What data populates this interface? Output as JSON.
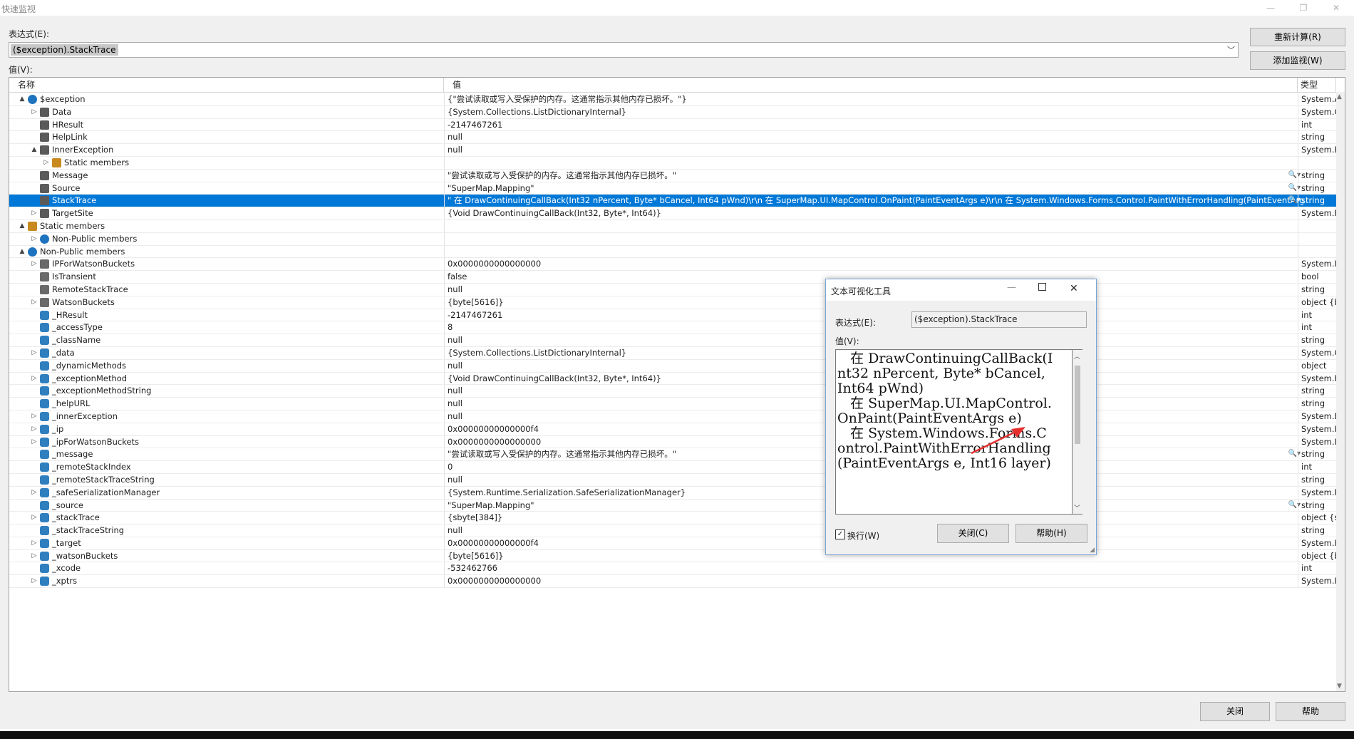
{
  "window": {
    "title": "快速监视",
    "minimize_icon": "minimize-icon",
    "restore_icon": "restore-icon",
    "close_icon": "close-icon"
  },
  "expression": {
    "label": "表达式(E):",
    "value": "($exception).StackTrace"
  },
  "buttons": {
    "recalculate": "重新计算(R)",
    "add_watch": "添加监视(W)",
    "close": "关闭",
    "help": "帮助"
  },
  "value_label": "值(V):",
  "grid": {
    "columns": {
      "name": "名称",
      "value": "值",
      "type": "类型"
    },
    "rows": [
      {
        "indent": 1,
        "exp": "▲",
        "icon": "object-icon",
        "name": "$exception",
        "value": "{\"尝试读取或写入受保护的内存。这通常指示其他内存已损坏。\"}",
        "type": "System.A"
      },
      {
        "indent": 2,
        "exp": "▷",
        "icon": "property-icon",
        "name": "Data",
        "value": "{System.Collections.ListDictionaryInternal}",
        "type": "System.C"
      },
      {
        "indent": 2,
        "exp": "",
        "icon": "property-icon",
        "name": "HResult",
        "value": "-2147467261",
        "type": "int"
      },
      {
        "indent": 2,
        "exp": "",
        "icon": "property-icon",
        "name": "HelpLink",
        "value": "null",
        "type": "string"
      },
      {
        "indent": 2,
        "exp": "▲",
        "icon": "property-icon",
        "name": "InnerException",
        "value": "null",
        "type": "System.E"
      },
      {
        "indent": 3,
        "exp": "▷",
        "icon": "static-members-icon",
        "name": "Static members",
        "value": "",
        "type": ""
      },
      {
        "indent": 2,
        "exp": "",
        "icon": "property-icon",
        "name": "Message",
        "value": "\"尝试读取或写入受保护的内存。这通常指示其他内存已损坏。\"",
        "type": "string",
        "mag": true
      },
      {
        "indent": 2,
        "exp": "",
        "icon": "property-icon",
        "name": "Source",
        "value": "\"SuperMap.Mapping\"",
        "type": "string",
        "mag": true
      },
      {
        "indent": 2,
        "exp": "",
        "icon": "property-icon",
        "name": "StackTrace",
        "value": "\"   在 DrawContinuingCallBack(Int32 nPercent, Byte* bCancel, Int64 pWnd)\\r\\n   在 SuperMap.UI.MapControl.OnPaint(PaintEventArgs e)\\r\\n   在 System.Windows.Forms.Control.PaintWithErrorHandling(PaintEventArgs e, Int1",
        "type": "string",
        "mag": true,
        "selected": true
      },
      {
        "indent": 2,
        "exp": "▷",
        "icon": "property-icon",
        "name": "TargetSite",
        "value": "{Void DrawContinuingCallBack(Int32, Byte*, Int64)}",
        "type": "System.F"
      },
      {
        "indent": 1,
        "exp": "▲",
        "icon": "static-members-icon",
        "name": "Static members",
        "value": "",
        "type": ""
      },
      {
        "indent": 2,
        "exp": "▷",
        "icon": "object-icon",
        "name": "Non-Public members",
        "value": "",
        "type": ""
      },
      {
        "indent": 1,
        "exp": "▲",
        "icon": "object-icon",
        "name": "Non-Public members",
        "value": "",
        "type": ""
      },
      {
        "indent": 2,
        "exp": "▷",
        "icon": "static-property-icon",
        "name": "IPForWatsonBuckets",
        "value": "0x0000000000000000",
        "type": "System.I"
      },
      {
        "indent": 2,
        "exp": "",
        "icon": "static-property-icon",
        "name": "IsTransient",
        "value": "false",
        "type": "bool"
      },
      {
        "indent": 2,
        "exp": "",
        "icon": "static-property-icon",
        "name": "RemoteStackTrace",
        "value": "null",
        "type": "string"
      },
      {
        "indent": 2,
        "exp": "▷",
        "icon": "static-property-icon",
        "name": "WatsonBuckets",
        "value": "{byte[5616]}",
        "type": "object {b"
      },
      {
        "indent": 2,
        "exp": "",
        "icon": "private-field-icon",
        "name": "_HResult",
        "value": "-2147467261",
        "type": "int"
      },
      {
        "indent": 2,
        "exp": "",
        "icon": "private-field-icon",
        "name": "_accessType",
        "value": "8",
        "type": "int"
      },
      {
        "indent": 2,
        "exp": "",
        "icon": "private-field-icon",
        "name": "_className",
        "value": "null",
        "type": "string"
      },
      {
        "indent": 2,
        "exp": "▷",
        "icon": "private-field-icon",
        "name": "_data",
        "value": "{System.Collections.ListDictionaryInternal}",
        "type": "System.C"
      },
      {
        "indent": 2,
        "exp": "",
        "icon": "private-field-icon",
        "name": "_dynamicMethods",
        "value": "null",
        "type": "object"
      },
      {
        "indent": 2,
        "exp": "▷",
        "icon": "private-field-icon",
        "name": "_exceptionMethod",
        "value": "{Void DrawContinuingCallBack(Int32, Byte*, Int64)}",
        "type": "System.F"
      },
      {
        "indent": 2,
        "exp": "",
        "icon": "private-field-icon",
        "name": "_exceptionMethodString",
        "value": "null",
        "type": "string"
      },
      {
        "indent": 2,
        "exp": "",
        "icon": "private-field-icon",
        "name": "_helpURL",
        "value": "null",
        "type": "string"
      },
      {
        "indent": 2,
        "exp": "▷",
        "icon": "private-field-icon",
        "name": "_innerException",
        "value": "null",
        "type": "System.E"
      },
      {
        "indent": 2,
        "exp": "▷",
        "icon": "private-field-icon",
        "name": "_ip",
        "value": "0x00000000000000f4",
        "type": "System.I"
      },
      {
        "indent": 2,
        "exp": "▷",
        "icon": "private-field-icon",
        "name": "_ipForWatsonBuckets",
        "value": "0x0000000000000000",
        "type": "System.I"
      },
      {
        "indent": 2,
        "exp": "",
        "icon": "private-field-icon",
        "name": "_message",
        "value": "\"尝试读取或写入受保护的内存。这通常指示其他内存已损坏。\"",
        "type": "string",
        "mag": true
      },
      {
        "indent": 2,
        "exp": "",
        "icon": "private-field-icon",
        "name": "_remoteStackIndex",
        "value": "0",
        "type": "int"
      },
      {
        "indent": 2,
        "exp": "",
        "icon": "private-field-icon",
        "name": "_remoteStackTraceString",
        "value": "null",
        "type": "string"
      },
      {
        "indent": 2,
        "exp": "▷",
        "icon": "private-field-icon",
        "name": "_safeSerializationManager",
        "value": "{System.Runtime.Serialization.SafeSerializationManager}",
        "type": "System.F"
      },
      {
        "indent": 2,
        "exp": "",
        "icon": "private-field-icon",
        "name": "_source",
        "value": "\"SuperMap.Mapping\"",
        "type": "string",
        "mag": true
      },
      {
        "indent": 2,
        "exp": "▷",
        "icon": "private-field-icon",
        "name": "_stackTrace",
        "value": "{sbyte[384]}",
        "type": "object {s"
      },
      {
        "indent": 2,
        "exp": "",
        "icon": "private-field-icon",
        "name": "_stackTraceString",
        "value": "null",
        "type": "string"
      },
      {
        "indent": 2,
        "exp": "▷",
        "icon": "private-field-icon",
        "name": "_target",
        "value": "0x00000000000000f4",
        "type": "System.I"
      },
      {
        "indent": 2,
        "exp": "▷",
        "icon": "private-field-icon",
        "name": "_watsonBuckets",
        "value": "{byte[5616]}",
        "type": "object {b"
      },
      {
        "indent": 2,
        "exp": "",
        "icon": "private-field-icon",
        "name": "_xcode",
        "value": "-532462766",
        "type": "int"
      },
      {
        "indent": 2,
        "exp": "▷",
        "icon": "private-field-icon",
        "name": "_xptrs",
        "value": "0x0000000000000000",
        "type": "System.I"
      }
    ]
  },
  "text_visualizer": {
    "title": "文本可视化工具",
    "expression_label": "表达式(E):",
    "expression_value": "($exception).StackTrace",
    "value_label": "值(V):",
    "text": "   在 DrawContinuingCallBack(Int32 nPercent, Byte* bCancel, Int64 pWnd)\n   在 SuperMap.UI.MapControl.OnPaint(PaintEventArgs e)\n   在 System.Windows.Forms.Control.PaintWithErrorHandling(PaintEventArgs e, Int16 layer)",
    "wrap_label": "换行(W)",
    "wrap_checked": true,
    "close_button": "关闭(C)",
    "help_button": "帮助(H)",
    "annotation_color": "#e53030"
  },
  "colors": {
    "selection": "#0078d7",
    "dialog_background": "#f0f0f0"
  }
}
